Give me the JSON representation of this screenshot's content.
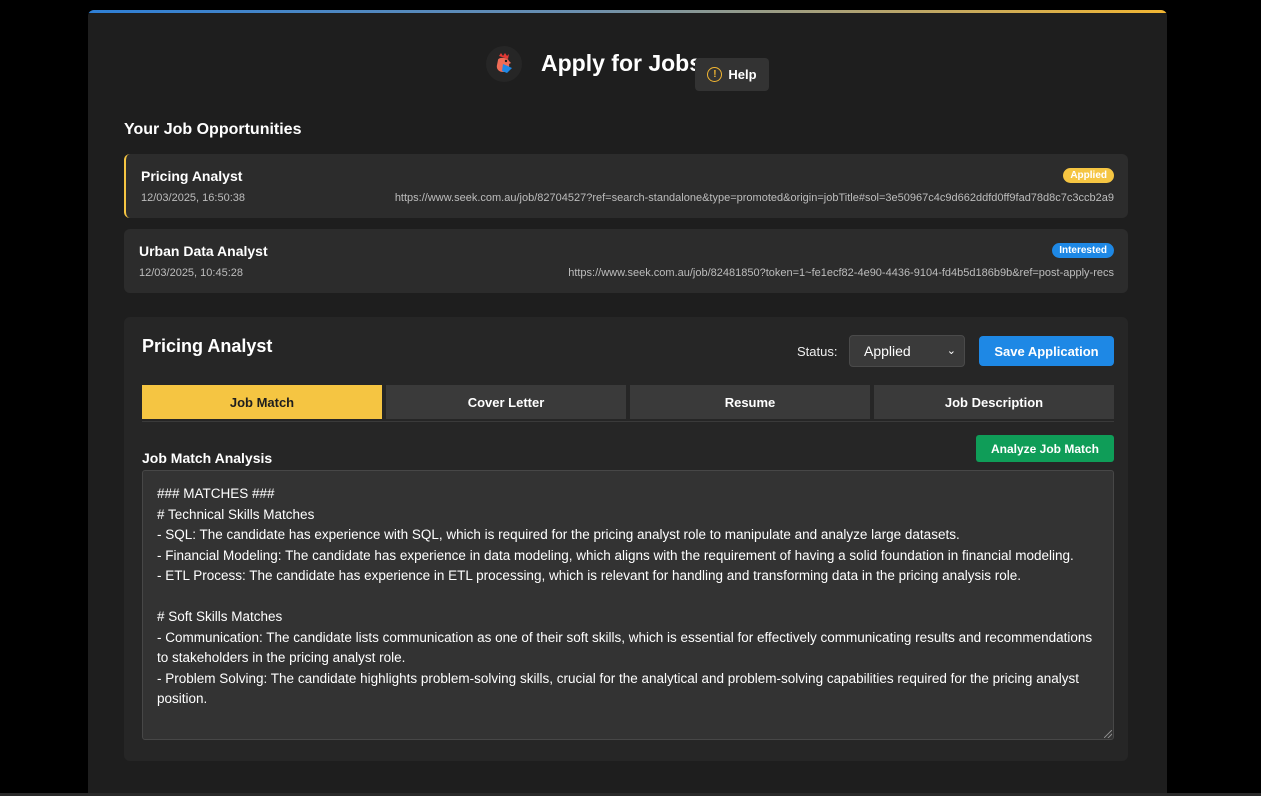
{
  "header": {
    "title": "Apply for Jobs",
    "help_label": "Help",
    "logo_icon": "rooster-logo-icon",
    "help_icon": "warning-circle-icon"
  },
  "jobs_section": {
    "title": "Your Job Opportunities",
    "items": [
      {
        "title": "Pricing Analyst",
        "date": "12/03/2025, 16:50:38",
        "url": "https://www.seek.com.au/job/82704527?ref=search-standalone&type=promoted&origin=jobTitle#sol=3e50967c4c9d662ddfd0ff9fad78d8c7c3ccb2a9",
        "status": "Applied"
      },
      {
        "title": "Urban Data Analyst",
        "date": "12/03/2025, 10:45:28",
        "url": "https://www.seek.com.au/job/82481850?token=1~fe1ecf82-4e90-4436-9104-fd4b5d186b9b&ref=post-apply-recs",
        "status": "Interested"
      }
    ]
  },
  "detail": {
    "title": "Pricing Analyst",
    "status_label": "Status:",
    "status_value": "Applied",
    "save_label": "Save Application",
    "tabs": [
      "Job Match",
      "Cover Letter",
      "Resume",
      "Job Description"
    ],
    "active_tab": "Job Match",
    "analysis_title": "Job Match Analysis",
    "analyze_label": "Analyze Job Match",
    "analysis_text": "### MATCHES ###\n# Technical Skills Matches\n- SQL: The candidate has experience with SQL, which is required for the pricing analyst role to manipulate and analyze large datasets.\n- Financial Modeling: The candidate has experience in data modeling, which aligns with the requirement of having a solid foundation in financial modeling.\n- ETL Process: The candidate has experience in ETL processing, which is relevant for handling and transforming data in the pricing analysis role.\n\n# Soft Skills Matches\n- Communication: The candidate lists communication as one of their soft skills, which is essential for effectively communicating results and recommendations to stakeholders in the pricing analyst role.\n- Problem Solving: The candidate highlights problem-solving skills, crucial for the analytical and problem-solving capabilities required for the pricing analyst position."
  },
  "colors": {
    "accent_yellow": "#f5c542",
    "accent_blue": "#1e88e5",
    "accent_green": "#0f9d58",
    "background": "#1e1e1e"
  }
}
